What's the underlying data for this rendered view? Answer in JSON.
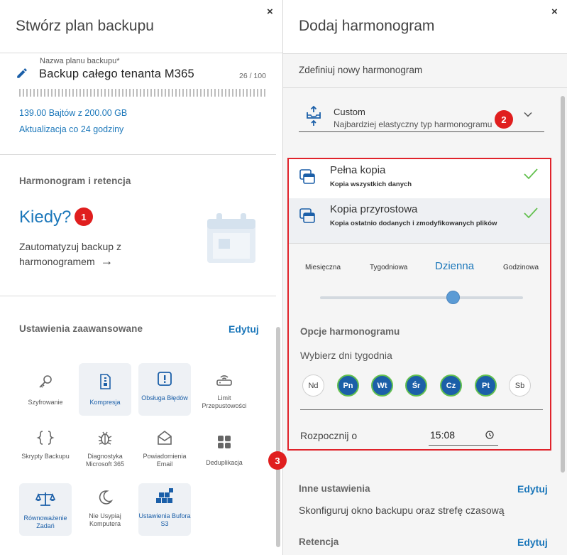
{
  "left_panel": {
    "title": "Stwórz plan backupu",
    "close": "×",
    "name_label": "Nazwa planu backupu*",
    "name_value": "Backup całego tenanta M365",
    "name_count": "26 / 100",
    "storage": "139.00 Bajtów z 200.00 GB",
    "update": "Aktualizacja co 24 godziny",
    "schedule_section": "Harmonogram i retencja",
    "kiedy": "Kiedy?",
    "badge_1": "1",
    "automate_text": "Zautomatyzuj backup z harmonogramem",
    "arrow": "→",
    "advanced_section": "Ustawienia zaawansowane",
    "edit": "Edytuj",
    "tiles": [
      {
        "label": "Szyfrowanie"
      },
      {
        "label": "Kompresja"
      },
      {
        "label": "Obsługa Błędów"
      },
      {
        "label": "Limit Przepustowości"
      },
      {
        "label": "Skrypty Backupu"
      },
      {
        "label": "Diagnostyka Microsoft 365"
      },
      {
        "label": "Powiadomienia Email"
      },
      {
        "label": "Deduplikacja"
      },
      {
        "label": "Równoważenie Zadań"
      },
      {
        "label": "Nie Usypiaj Komputera"
      },
      {
        "label": "Ustawienia Bufora S3"
      }
    ]
  },
  "right_panel": {
    "title": "Dodaj harmonogram",
    "close": "×",
    "define": "Zdefiniuj nowy harmonogram",
    "dropdown": {
      "title": "Custom",
      "subtitle": "Najbardziej elastyczny typ harmonogramu"
    },
    "badge_2": "2",
    "badge_3": "3",
    "options": [
      {
        "title": "Pełna kopia",
        "subtitle": "Kopia wszystkich danych"
      },
      {
        "title": "Kopia przyrostowa",
        "subtitle": "Kopia ostatnio dodanych i zmodyfikowanych plików"
      }
    ],
    "frequencies": [
      "Miesięczna",
      "Tygodniowa",
      "Dzienna",
      "Godzinowa"
    ],
    "selected_frequency": "Dzienna",
    "options_title": "Opcje harmonogramu",
    "choose_days": "Wybierz dni tygodnia",
    "days": [
      {
        "label": "Nd",
        "on": false
      },
      {
        "label": "Pn",
        "on": true
      },
      {
        "label": "Wt",
        "on": true
      },
      {
        "label": "Śr",
        "on": true
      },
      {
        "label": "Cz",
        "on": true
      },
      {
        "label": "Pt",
        "on": true
      },
      {
        "label": "Sb",
        "on": false
      }
    ],
    "start_label": "Rozpocznij o",
    "start_time": "15:08",
    "other_settings": "Inne ustawienia",
    "other_edit": "Edytuj",
    "configure": "Skonfiguruj okno backupu oraz strefę czasową",
    "retention": "Retencja",
    "retention_edit": "Edytuj"
  },
  "colors": {
    "accent": "#1b77ba",
    "badge": "#e01e1e",
    "highlight_border": "#e0232b",
    "day_on": "#1b5fa8",
    "day_ring": "#62c04e",
    "check": "#62c04e"
  }
}
